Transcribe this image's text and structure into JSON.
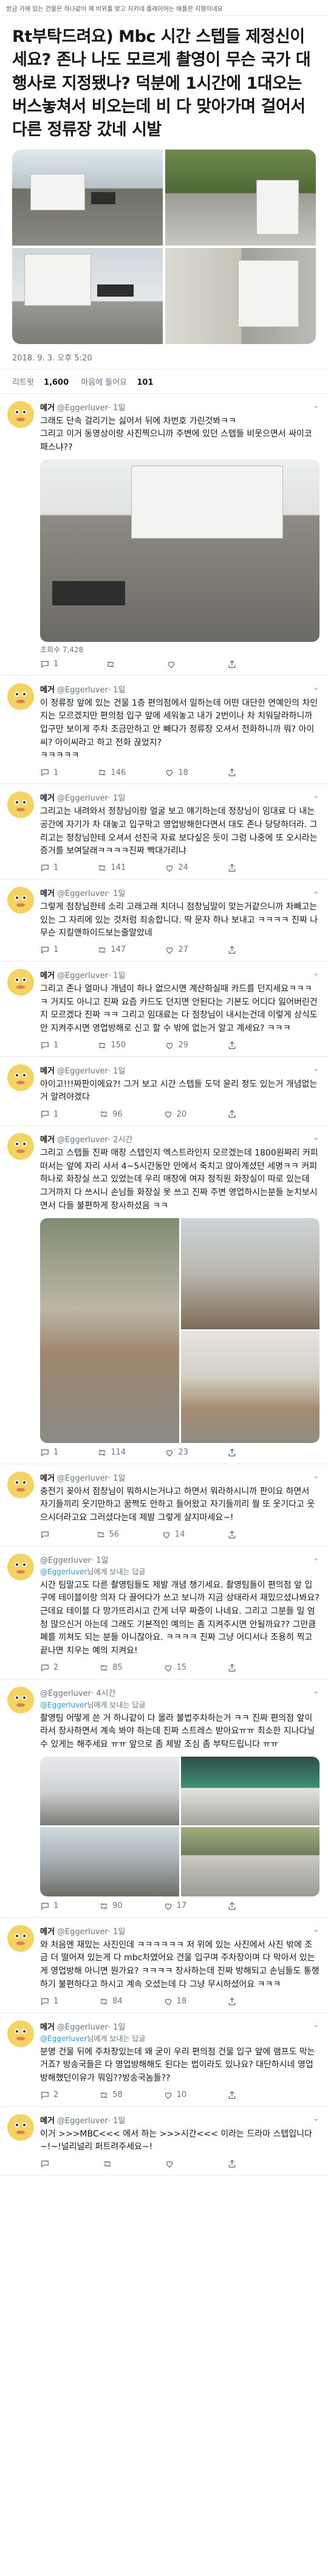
{
  "topbar": {
    "text": "방금 가에 있는 건물은 하나같이 제 비위를 맞고 지키네 플레이어는 애플한 지형이네요"
  },
  "main_tweet": {
    "text": "Rt부탁드려요) Mbc 시간 스텝들 제정신이세요? 존나 나도 모르게 촬영이 무슨 국가 대행사로 지정됐나? 덕분에 1시간에 1대오는 버스놓쳐서 비오는데 비 다 맞아가며 걸어서 다른 정류장 갔네 시발",
    "timestamp": "2018. 9. 3. 오후 5:20"
  },
  "stats": {
    "retweets": "1,600",
    "retweets_label": "리트윗",
    "likes": "101",
    "likes_label": "마음에 들어요"
  },
  "replies": [
    {
      "name": "메거",
      "handle": "@Eggerluver",
      "time": "· 1일",
      "text": "그래도 단속 걸리기는 싫어서 뒤에 차번호 가린것봐ㅋㅋ\n그리고 이거 동영상이랑 사진찍으니까 주변에 있던 스텝들 비웃으면서 싸이코패스냐??",
      "views": "조회수 7,428",
      "actions": {
        "reply": "1",
        "retweet": "",
        "like": ""
      }
    },
    {
      "name": "메거",
      "handle": "@Eggerluver",
      "time": "· 1일",
      "text": "이 정류장 앞에 있는 건물 1층 편의점에서 일하는데 어떤 대단한 연예인의 차인지는 모르겠지만 편의점 입구 앞에 세워놓고 내가 2번이나 차 치워달라하니까 입구만 보이게 주차 조금만하고 안 빼다가 정류장 오셔서 전화하니까 뭐? 아이씨? 아이씨라고 하고 전화 끊었지?\nㅋㅋㅋㅋㅋ",
      "actions": {
        "reply": "1",
        "retweet": "146",
        "like": "18"
      }
    },
    {
      "name": "메거",
      "handle": "@Eggerluver",
      "time": "· 1일",
      "text": "그리고는 내려와서 정창님이랑 얼굴 보고 얘기하는데 정창님이 임대료 다 내는 공간에 자기가 차 대놓고 입구막고 영업방해한다면서 대도 존나 당당하더라. 그리고는 정창님한테 오셔서 선진국 자료 보다싶은 듯이 그럼 나중에 또 오시라는 증거를 보여달래ㅋㅋㅋㅋ진짜 빡대가리냐",
      "actions": {
        "reply": "1",
        "retweet": "141",
        "like": "24"
      }
    },
    {
      "name": "메거",
      "handle": "@Eggerluver",
      "time": "· 1일",
      "text": "그렇게 점창님한테 소리 고래고래 치더니 점창님말이 맞는거같으니까 차빼고는 있는 그 자리에 있는 것처럼 죄송합니다. 딱 문자 하나 보내고 ㅋㅋㅋㅋ 진짜 나 무슨 지킬앤하이드보는줄알았네",
      "actions": {
        "reply": "1",
        "retweet": "147",
        "like": "27"
      }
    },
    {
      "name": "메거",
      "handle": "@Eggerluver",
      "time": "· 1일",
      "text": "그리고 존나 얼마나 개념이 하나 없으시면 계산하실때 카드를 던지세요ㅋㅋㅋㅋ 거지도 아니고 진짜 요즘 카드도 던지면 안된다는 기본도 어디다 잃어버린건지 모르겠다 진짜 ㅋㅋ 그리고 임대료는 다 점창님이 내시는건데 이렇게 상식도 안 지켜주시면 영업방해로 신고 할 수 밖에 없는거 알고 계세요? ㅋㅋㅋ",
      "actions": {
        "reply": "1",
        "retweet": "150",
        "like": "29"
      }
    },
    {
      "name": "메거",
      "handle": "@Eggerluver",
      "time": "· 1일",
      "text": "아이고!!!짜판이에요?! 그거 보고 시간 스텝들 도덕 윤리 정도 있는거 개념없는거 알려야겠다",
      "actions": {
        "reply": "1",
        "retweet": "96",
        "like": "20"
      }
    },
    {
      "name": "메거",
      "handle": "@Eggerluver",
      "time": "· 2시간",
      "text": "그리고 스텝들 진짜 매장 스텝인지 엑스트라인지 모르겠는데 1800원짜리 커피떠서는 앞에 자리 사서 4~5시간동안 안에서 죽치고 앉아계셨던 세명ㅋㅋ 커피 하나로 화장실 쓰고 있었는데 우리 매장에 여자 정직원 화장실이 따로 있는데 그거까지 다 쓰시니 손님들 화장실 못 쓰고 진짜 주변 영업하시는분들 눈치보시면서 다들 불편하게 장사하셨음 ㅋㅋ",
      "actions": {
        "reply": "1",
        "retweet": "114",
        "like": "23"
      }
    },
    {
      "name": "메거",
      "handle": "@Eggerluver",
      "time": "· 1일",
      "text": "충전기 꽂아서 점창님이 뭐하시는거냐고 하면서 뭐라하시니까 판이요 하면서 자기들끼리 웃기만하고 꿈쩍도 안하고 들어왔고 자기들끼리 뭘 또 웃기다고 웃으시더라고요 그러셨다는데 제발 그렇게 살지마세요~!",
      "actions": {
        "reply": "",
        "retweet": "56",
        "like": "14"
      }
    },
    {
      "name": "",
      "handle": "@Eggerluver",
      "replying_prefix": "님에게 보내는 답글",
      "time": "· 1일",
      "text": "시간 팀말고도 다른 촬영팀들도 제발 개념 챙기세요. 촬영팀들이 편의점 앞 입구에 테이블이랑 의자 다 끌어다가 쓰고 보니까 지금 상태라서 재밌으셨나봐요? 근데요 테이블 다 망가뜨리시고 간게 너무 짜증이 나네요. 그리고 그분들 일 엄청 많으신거 아는데 그래도 기본적인 예의는 좀 지켜주시면 안될까요?? 그만큼 폐를 끼쳐도 되는 분들 아니잖아요. ㅋㅋㅋㅋ 진짜 그냥 어디서나 조용히 찍고 끝나면 치우는 예의 지켜요!",
      "actions": {
        "reply": "2",
        "retweet": "85",
        "like": "15"
      }
    },
    {
      "name": "",
      "handle": "@Eggerluver",
      "replying_prefix": "님에게 보내는 답글",
      "time": "· 4시간",
      "text": "촬영팀 어떻게 쓴 거 하나같이 다 몰라 불법주차하는거 ㅋㅋ 진짜 편의점 앞이라서 장사하면서 계속 봐야 하는데 진짜 스트레스 받아요ㅠㅠ 최소한 지나다닐 수 있게는 해주세요 ㅠㅠ 앞으로 좀 제발 조심 좀 부탁드립니다 ㅠㅠ",
      "actions": {
        "reply": "1",
        "retweet": "90",
        "like": "17"
      }
    },
    {
      "name": "메거",
      "handle": "@Eggerluver",
      "time": "· 1일",
      "text": "와 처음엔 재밌는 사진인데 ㅋㅋㅋㅋㅋㅋ 저 위에 있는 사진에서 사진 밖에 조금 더 떨어져 있는게 다 mbc차였어요 건물 입구며 주차장이며 다 막아서 있는게 영업방해 아니면 뭔가요? ㅋㅋㅋㅋ 장사하는데 진짜 방해되고 손님들도 통행하기 불편하다고 하시고 계속 오셨는데 다 그냥 무시하셨어요 ㅋㅋㅋ",
      "actions": {
        "reply": "1",
        "retweet": "84",
        "like": "18"
      }
    },
    {
      "name": "메거",
      "handle": "@Eggerluver",
      "replying_prefix": "님에게 보내는 답글",
      "time": "· 1일",
      "text": "분명 건물 뒤에 주차장있는데 왜 굳이 우리 편의점 건물 입구 앞에 램프도 막는 거죠? 방송국들은 다 영업방해해도 된다는 법이라도 있나요? 대단하시네 영업방해했던이유가 뭐임??방송국놈들??",
      "actions": {
        "reply": "2",
        "retweet": "58",
        "like": "10"
      }
    },
    {
      "name": "메거",
      "handle": "@Eggerluver",
      "time": "· 1일",
      "text": "이거 >>>MBC<<< 에서 하는 >>>시간<<< 이라는 드라마 스텝입니다~!~!널리널리 퍼트려주세요~!",
      "actions": {
        "reply": "",
        "retweet": "",
        "like": ""
      }
    }
  ]
}
